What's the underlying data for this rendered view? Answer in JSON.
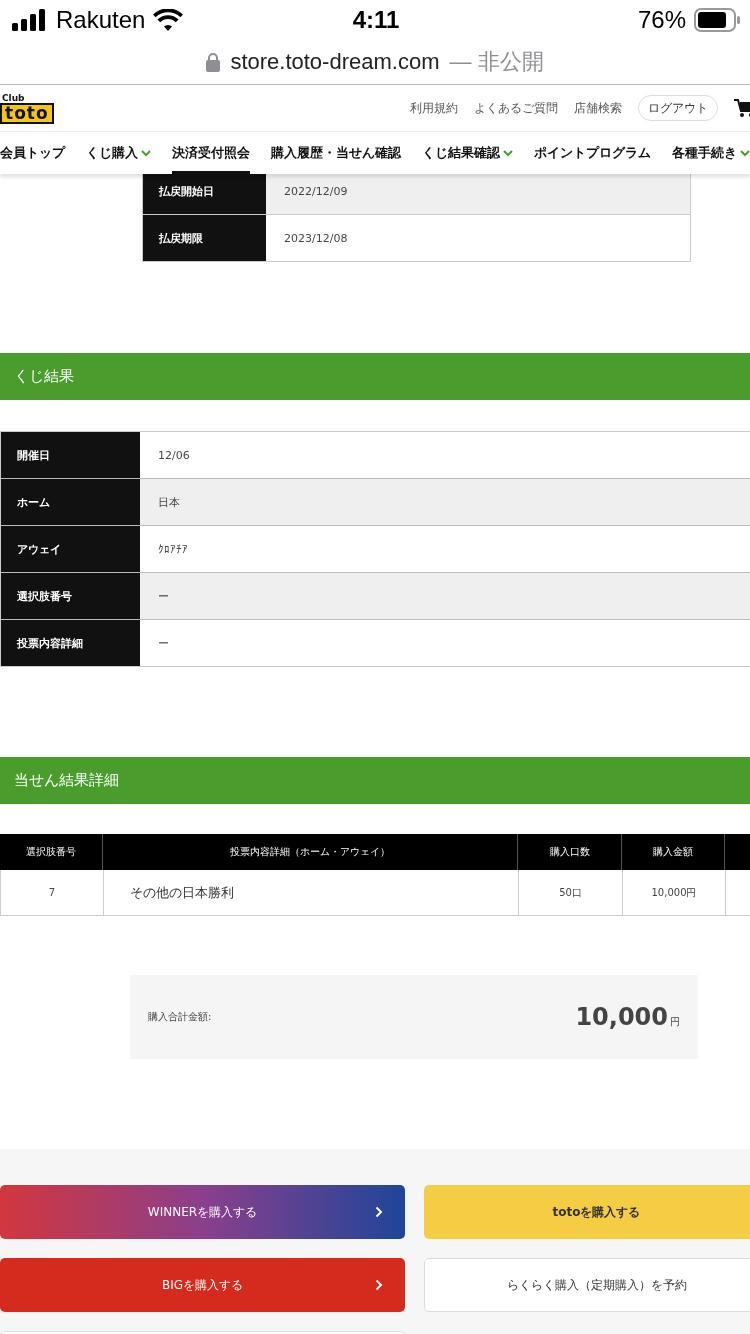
{
  "status_bar": {
    "carrier": "Rakuten",
    "time": "4:11",
    "battery": "76%"
  },
  "address_bar": {
    "url": "store.toto-dream.com",
    "note": "— 非公開"
  },
  "header": {
    "logo_top": "Club",
    "logo_main": "toto",
    "links": [
      "利用規約",
      "よくあるご質問",
      "店舗検索"
    ],
    "logout": "ログアウト"
  },
  "nav": [
    {
      "label": "会員トップ",
      "dropdown": false,
      "selected": false
    },
    {
      "label": "くじ購入",
      "dropdown": true,
      "selected": false
    },
    {
      "label": "決済受付照会",
      "dropdown": false,
      "selected": true
    },
    {
      "label": "購入履歴・当せん確認",
      "dropdown": false,
      "selected": false
    },
    {
      "label": "くじ結果確認",
      "dropdown": true,
      "selected": false
    },
    {
      "label": "ポイントプログラム",
      "dropdown": false,
      "selected": false
    },
    {
      "label": "各種手続き",
      "dropdown": true,
      "selected": false
    }
  ],
  "payout_table": [
    {
      "label": "払戻開始日",
      "value": "2022/12/09"
    },
    {
      "label": "払戻期限",
      "value": "2023/12/08"
    }
  ],
  "result_section": {
    "title": "くじ結果",
    "rows": [
      {
        "label": "開催日",
        "value": "12/06"
      },
      {
        "label": "ホーム",
        "value": "日本"
      },
      {
        "label": "アウェイ",
        "value": "ｸﾛｱﾁｱ"
      },
      {
        "label": "選択肢番号",
        "value": "ー"
      },
      {
        "label": "投票内容詳細",
        "value": "ー"
      }
    ]
  },
  "detail_section": {
    "title": "当せん結果詳細",
    "columns": [
      "選択肢番号",
      "投票内容詳細（ホーム・アウェイ）",
      "購入口数",
      "購入金額"
    ],
    "rows": [
      {
        "cells": [
          "7",
          "その他の日本勝利",
          "50口",
          "10,000円"
        ]
      }
    ],
    "total_label": "購入合計金額:",
    "total_amount": "10,000",
    "total_unit": "円"
  },
  "footer_buttons": [
    {
      "label": "WINNERを購入する",
      "kind": "gradient",
      "arrow": true
    },
    {
      "label": "totoを購入する",
      "kind": "yellow",
      "arrow": false
    },
    {
      "label": "BIGを購入する",
      "kind": "red",
      "arrow": true
    },
    {
      "label": "らくらく購入（定期購入）を予約",
      "kind": "white",
      "arrow": false
    },
    {
      "kind": "white"
    }
  ]
}
